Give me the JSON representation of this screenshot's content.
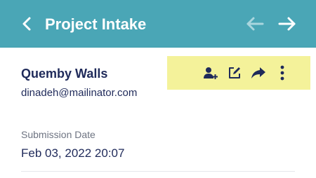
{
  "header": {
    "title": "Project Intake",
    "background": "#4aa6b6",
    "back_icon": "chevron-left-icon",
    "prev_icon": "arrow-left-icon",
    "next_icon": "arrow-right-icon"
  },
  "contact": {
    "name": "Quemby Walls",
    "email": "dinadeh@mailinator.com",
    "actions": [
      {
        "name": "assign-user-icon"
      },
      {
        "name": "edit-icon"
      },
      {
        "name": "share-icon"
      },
      {
        "name": "more-vertical-icon"
      }
    ],
    "actions_highlight": "#f4f29a"
  },
  "fields": [
    {
      "label": "Submission Date",
      "value": "Feb 03, 2022 20:07"
    }
  ]
}
